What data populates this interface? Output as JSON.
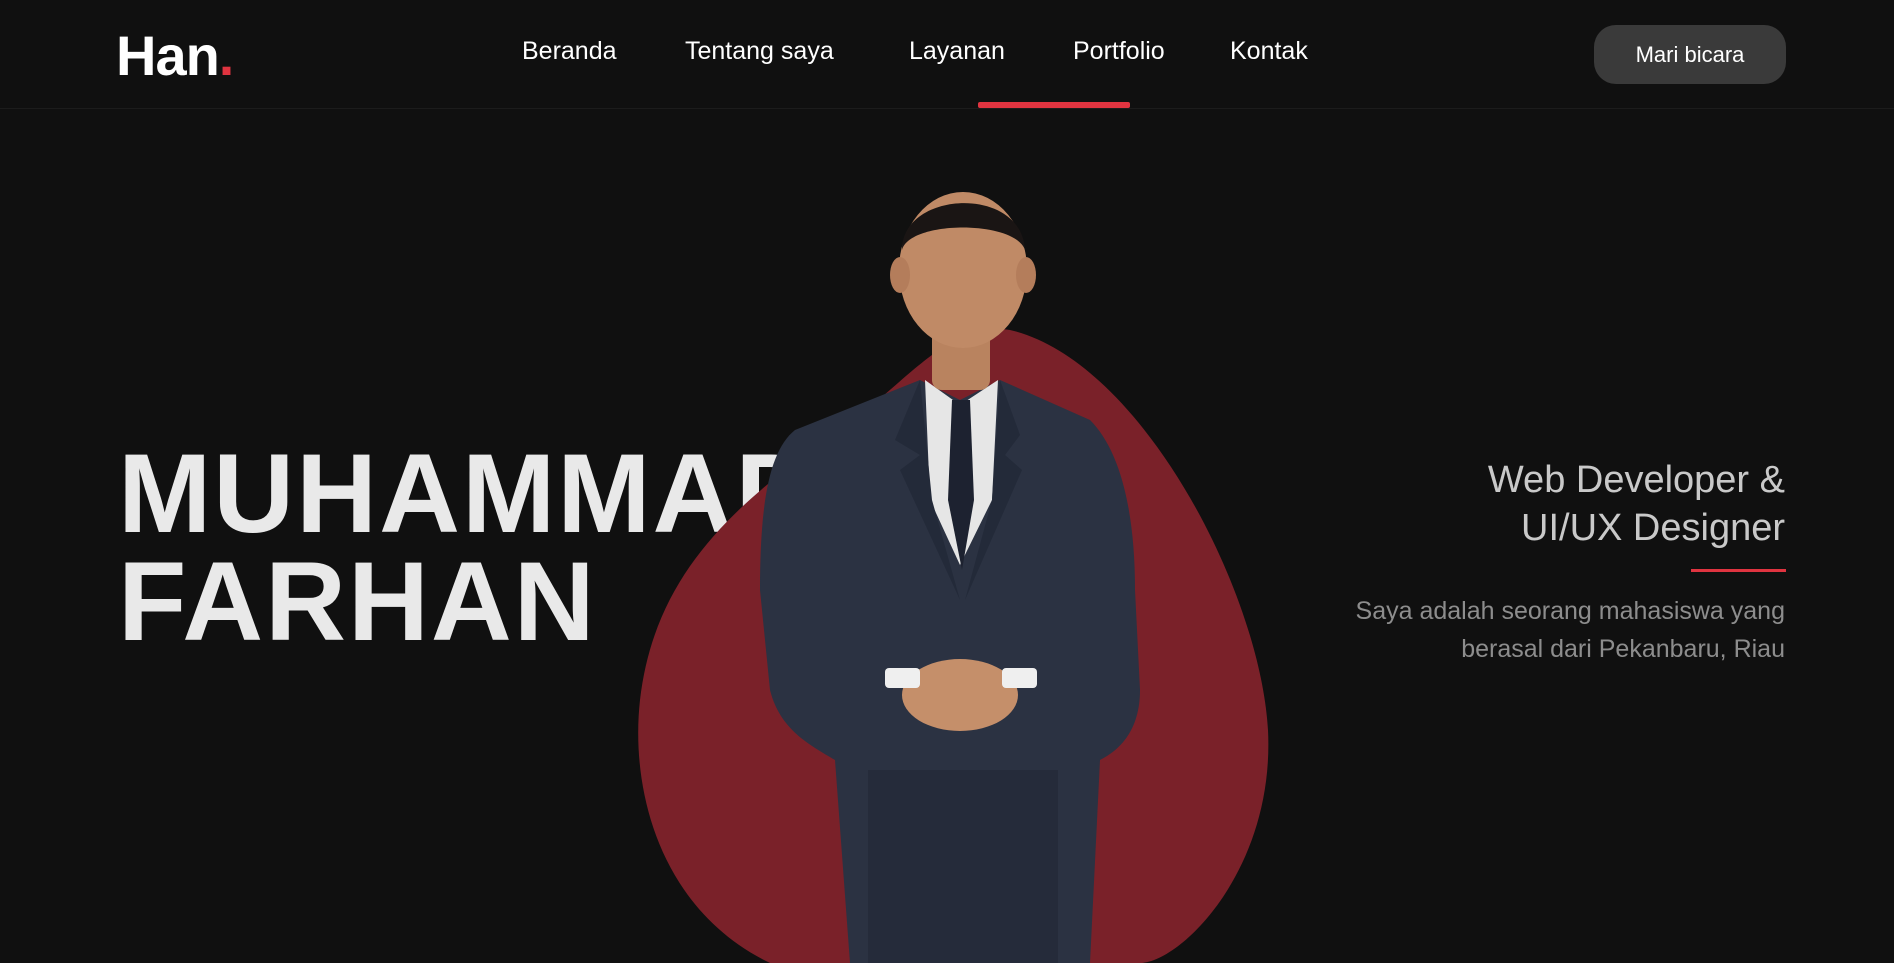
{
  "brand": {
    "logo_text": "Han",
    "logo_dot": "."
  },
  "nav": {
    "items": [
      {
        "label": "Beranda"
      },
      {
        "label": "Tentang saya"
      },
      {
        "label": "Layanan"
      },
      {
        "label": "Portfolio"
      },
      {
        "label": "Kontak"
      }
    ],
    "active_index": 2
  },
  "cta": {
    "label": "Mari bicara"
  },
  "hero": {
    "name_line1": "MUHAMMAD",
    "name_line2": "FARHAN",
    "role_line1": "Web Developer &",
    "role_line2": "UI/UX Designer",
    "bio_line1": "Saya adalah seorang mahasiswa yang",
    "bio_line2": "berasal dari Pekanbaru, Riau"
  },
  "colors": {
    "background": "#101010",
    "accent": "#e03440",
    "blob": "#7a2129",
    "button_bg": "#3a3a3a"
  }
}
